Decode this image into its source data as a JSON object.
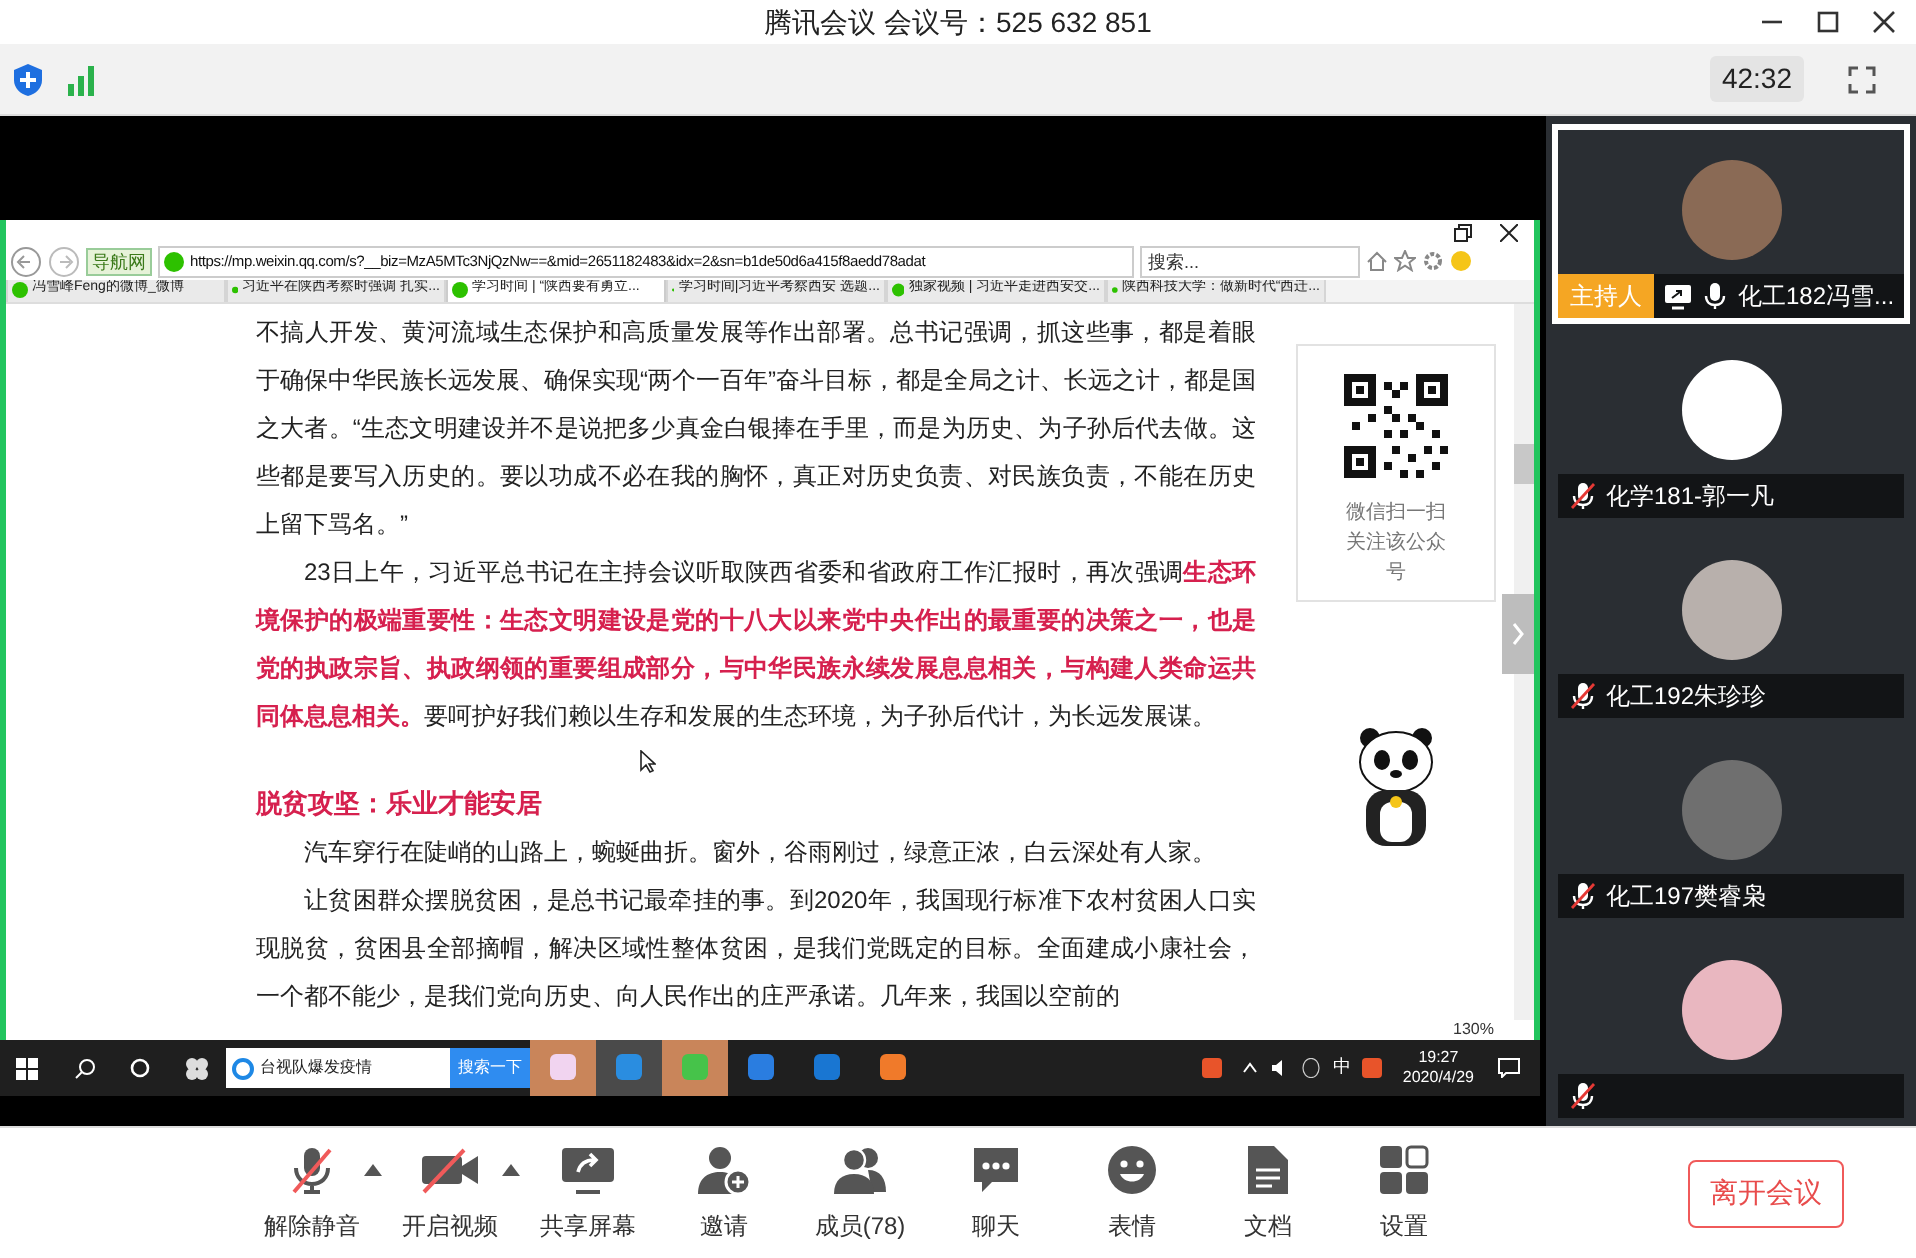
{
  "title_bar": {
    "app": "腾讯会议",
    "meeting_id": "会议号：525 632 851"
  },
  "status_bar": {
    "timer": "42:32"
  },
  "shared_screen": {
    "browser": {
      "nav_label": "导航网",
      "address": "https://mp.weixin.qq.com/s?__biz=MzA5MTc3NjQzNw==&mid=2651182483&idx=2&sn=b1de50d6a415f8aedd78adat",
      "search_placeholder": "搜索...",
      "zoom": "130%",
      "tabs": [
        {
          "label": "冯雪峰Feng的微博_微博",
          "selected": false
        },
        {
          "label": "习近平在陕西考察时强调 扎实...",
          "selected": false
        },
        {
          "label": "学习时间 | “陕西要有勇立...",
          "selected": true
        },
        {
          "label": "学习时间|习近平考察西安 选题...",
          "selected": false
        },
        {
          "label": "独家视频 | 习近平走进西安交...",
          "selected": false
        },
        {
          "label": "陕西科技大学：做新时代“西迁...",
          "selected": false
        }
      ]
    },
    "article": {
      "blocks": [
        {
          "kind": "paragraph",
          "indent": false,
          "text": "不搞人开发、黄河流域生态保护和高质量发展等作出部署。总书记强调，抓这些事，都是着眼于确保中华民族长远发展、确保实现“两个一百年”奋斗目标，都是全局之计、长远之计，都是国之大者。“生态文明建设并不是说把多少真金白银捧在手里，而是为历史、为子孙后代去做。这些都是要写入历史的。要以功成不必在我的胸怀，真正对历史负责、对民族负责，不能在历史上留下骂名。”"
        },
        {
          "kind": "paragraph",
          "indent": true,
          "text": "23日上午，习近平总书记在主持会议听取陕西省委和省政府工作汇报时，再次强调**生态环境保护的极端重要性：生态文明建设是党的十八大以来党中央作出的最重要的决策之一，也是党的执政宗旨、执政纲领的重要组成部分，与中华民族永续发展息息相关，与构建人类命运共同体息息相关。**要呵护好我们赖以生存和发展的生态环境，为子孙后代计，为长远发展谋。"
        },
        {
          "kind": "heading",
          "indent": false,
          "text": "脱贫攻坚：乐业才能安居"
        },
        {
          "kind": "paragraph",
          "indent": true,
          "text": "汽车穿行在陡峭的山路上，蜿蜒曲折。窗外，谷雨刚过，绿意正浓，白云深处有人家。"
        },
        {
          "kind": "paragraph",
          "indent": true,
          "text": "让贫困群众摆脱贫困，是总书记最牵挂的事。到2020年，我国现行标准下农村贫困人口实现脱贫，贫困县全部摘帽，解决区域性整体贫困，是我们党既定的目标。全面建成小康社会，一个都不能少，是我们党向历史、向人民作出的庄严承诺。几年来，我国以空前的"
        }
      ],
      "qr_caption": "微信扫一扫关注该公众号"
    },
    "taskbar": {
      "search_value": "台视队爆发疫情",
      "search_button": "搜索一下",
      "ime": "中",
      "time": "19:27",
      "date": "2020/4/29"
    }
  },
  "participants": [
    {
      "name": "化工182冯雪...",
      "badge": "主持人",
      "sharing": true,
      "muted": false,
      "selected": true
    },
    {
      "name": "化学181-郭一凡",
      "sharing": false,
      "muted": true,
      "selected": false
    },
    {
      "name": "化工192朱珍珍",
      "sharing": false,
      "muted": true,
      "selected": false
    },
    {
      "name": "化工197樊睿枭",
      "sharing": false,
      "muted": true,
      "selected": false
    },
    {
      "sharing": false,
      "muted": true,
      "selected": false
    }
  ],
  "toolbar": {
    "items": [
      {
        "kind": "mic",
        "label": "解除静音",
        "off": true,
        "menu": true
      },
      {
        "kind": "camera",
        "label": "开启视频",
        "off": true,
        "menu": true
      },
      {
        "kind": "share",
        "label": "共享屏幕"
      },
      {
        "kind": "invite",
        "label": "邀请"
      },
      {
        "kind": "members",
        "label": "成员(78)"
      },
      {
        "kind": "chat",
        "label": "聊天"
      },
      {
        "kind": "emoji",
        "label": "表情"
      },
      {
        "kind": "docs",
        "label": "文档"
      },
      {
        "kind": "settings",
        "label": "设置"
      }
    ],
    "leave_button": "离开会议"
  }
}
